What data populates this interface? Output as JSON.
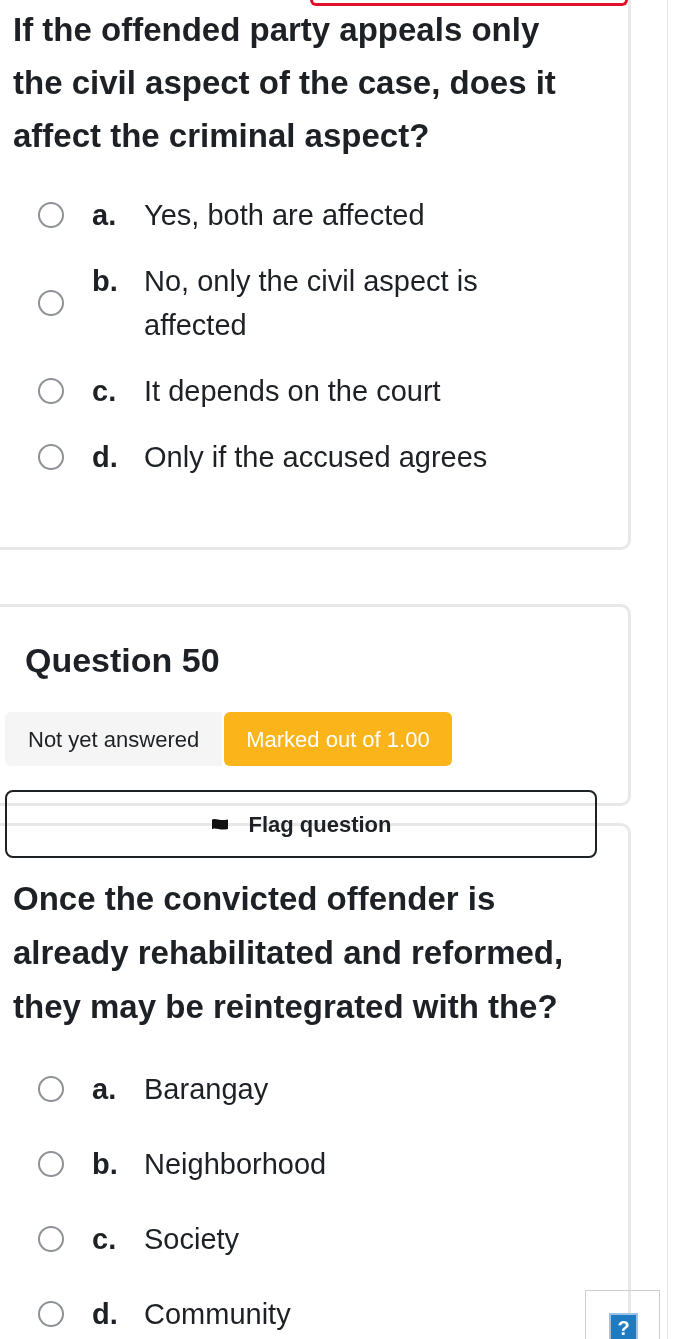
{
  "previous_question": {
    "text": "If the offended party appeals only the civil aspect of the case, does it affect the criminal aspect?",
    "options": [
      {
        "letter": "a.",
        "text": "Yes, both are affected",
        "selected": false
      },
      {
        "letter": "b.",
        "text": "No, only the civil aspect is affected",
        "selected": false
      },
      {
        "letter": "c.",
        "text": "It depends on the court",
        "selected": false
      },
      {
        "letter": "d.",
        "text": "Only if the accused agrees",
        "selected": false
      }
    ]
  },
  "question": {
    "title": "Question 50",
    "status": "Not yet answered",
    "grade": "Marked out of 1.00",
    "flag_button": "Flag question",
    "text": "Once the convicted offender is already rehabilitated and reformed, they may be reintegrated with the?",
    "options": [
      {
        "letter": "a.",
        "text": "Barangay",
        "selected": false
      },
      {
        "letter": "b.",
        "text": "Neighborhood",
        "selected": false
      },
      {
        "letter": "c.",
        "text": "Society",
        "selected": false
      },
      {
        "letter": "d.",
        "text": "Community",
        "selected": false
      }
    ]
  },
  "help_button": "?"
}
